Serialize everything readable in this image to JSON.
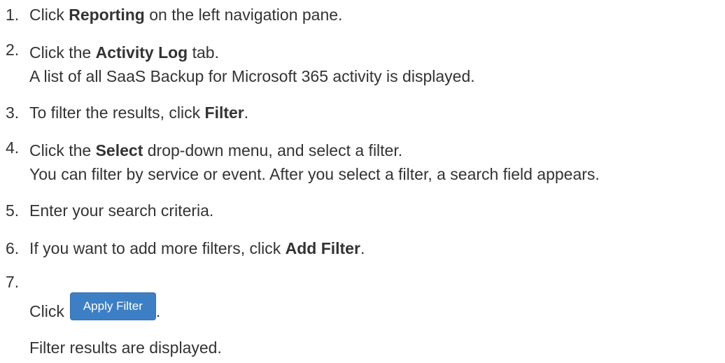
{
  "steps": [
    {
      "number": "1.",
      "pre": "Click ",
      "bold": "Reporting",
      "post": " on the left navigation pane."
    },
    {
      "number": "2.",
      "pre": "Click the ",
      "bold": "Activity Log",
      "post": " tab.",
      "note": "A list of all SaaS Backup for Microsoft 365 activity is displayed."
    },
    {
      "number": "3.",
      "pre": "To filter the results, click ",
      "bold": "Filter",
      "post": "."
    },
    {
      "number": "4.",
      "pre": "Click the ",
      "bold": "Select",
      "post": " drop-down menu, and select a filter.",
      "note": "You can filter by service or event. After you select a filter, a search field appears."
    },
    {
      "number": "5.",
      "text": "Enter your search criteria."
    },
    {
      "number": "6.",
      "pre": "If you want to add more filters, click ",
      "bold": "Add Filter",
      "post": "."
    },
    {
      "number": "7.",
      "pre": "Click",
      "button": "Apply Filter",
      "post": ".",
      "note": "Filter results are displayed."
    }
  ]
}
